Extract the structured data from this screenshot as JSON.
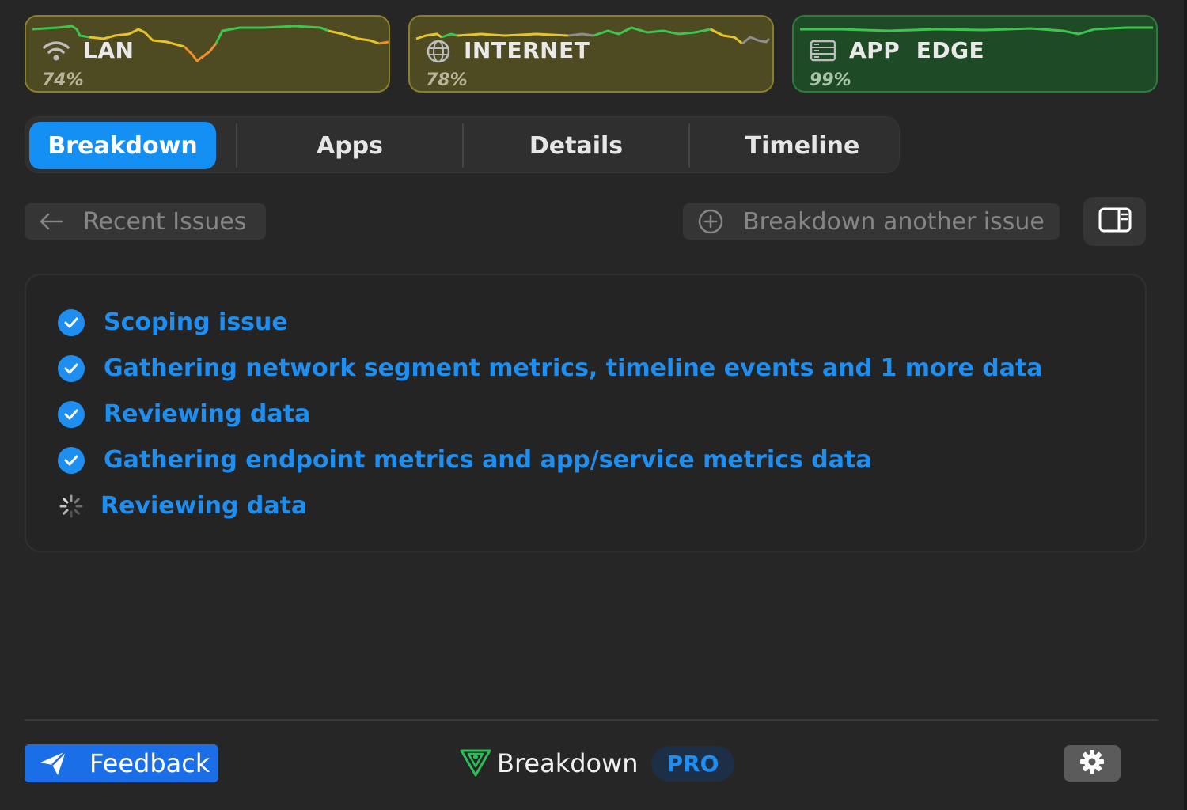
{
  "segments": [
    {
      "name": "LAN",
      "percent": "74%",
      "status": "yellow",
      "icon": "wifi-icon"
    },
    {
      "name": "INTERNET",
      "percent": "78%",
      "status": "yellow",
      "icon": "globe-icon"
    },
    {
      "name": "APP  EDGE",
      "percent": "99%",
      "status": "green",
      "icon": "server-icon"
    }
  ],
  "tabs": [
    {
      "label": "Breakdown",
      "active": true
    },
    {
      "label": "Apps",
      "active": false
    },
    {
      "label": "Details",
      "active": false
    },
    {
      "label": "Timeline",
      "active": false
    }
  ],
  "actions": {
    "back_label": "Recent Issues",
    "another_label": "Breakdown another issue"
  },
  "steps": [
    {
      "label": "Scoping issue",
      "state": "done"
    },
    {
      "label": "Gathering network segment metrics, timeline events and 1 more data",
      "state": "done"
    },
    {
      "label": "Reviewing data",
      "state": "done"
    },
    {
      "label": "Gathering endpoint metrics and app/service metrics data",
      "state": "done"
    },
    {
      "label": "Reviewing data",
      "state": "in-progress"
    }
  ],
  "footer": {
    "feedback_label": "Feedback",
    "brand_name": "Breakdown",
    "badge": "PRO"
  },
  "colors": {
    "accent": "#1490f5",
    "warning": "#e5c32a",
    "good": "#3ec44f"
  }
}
